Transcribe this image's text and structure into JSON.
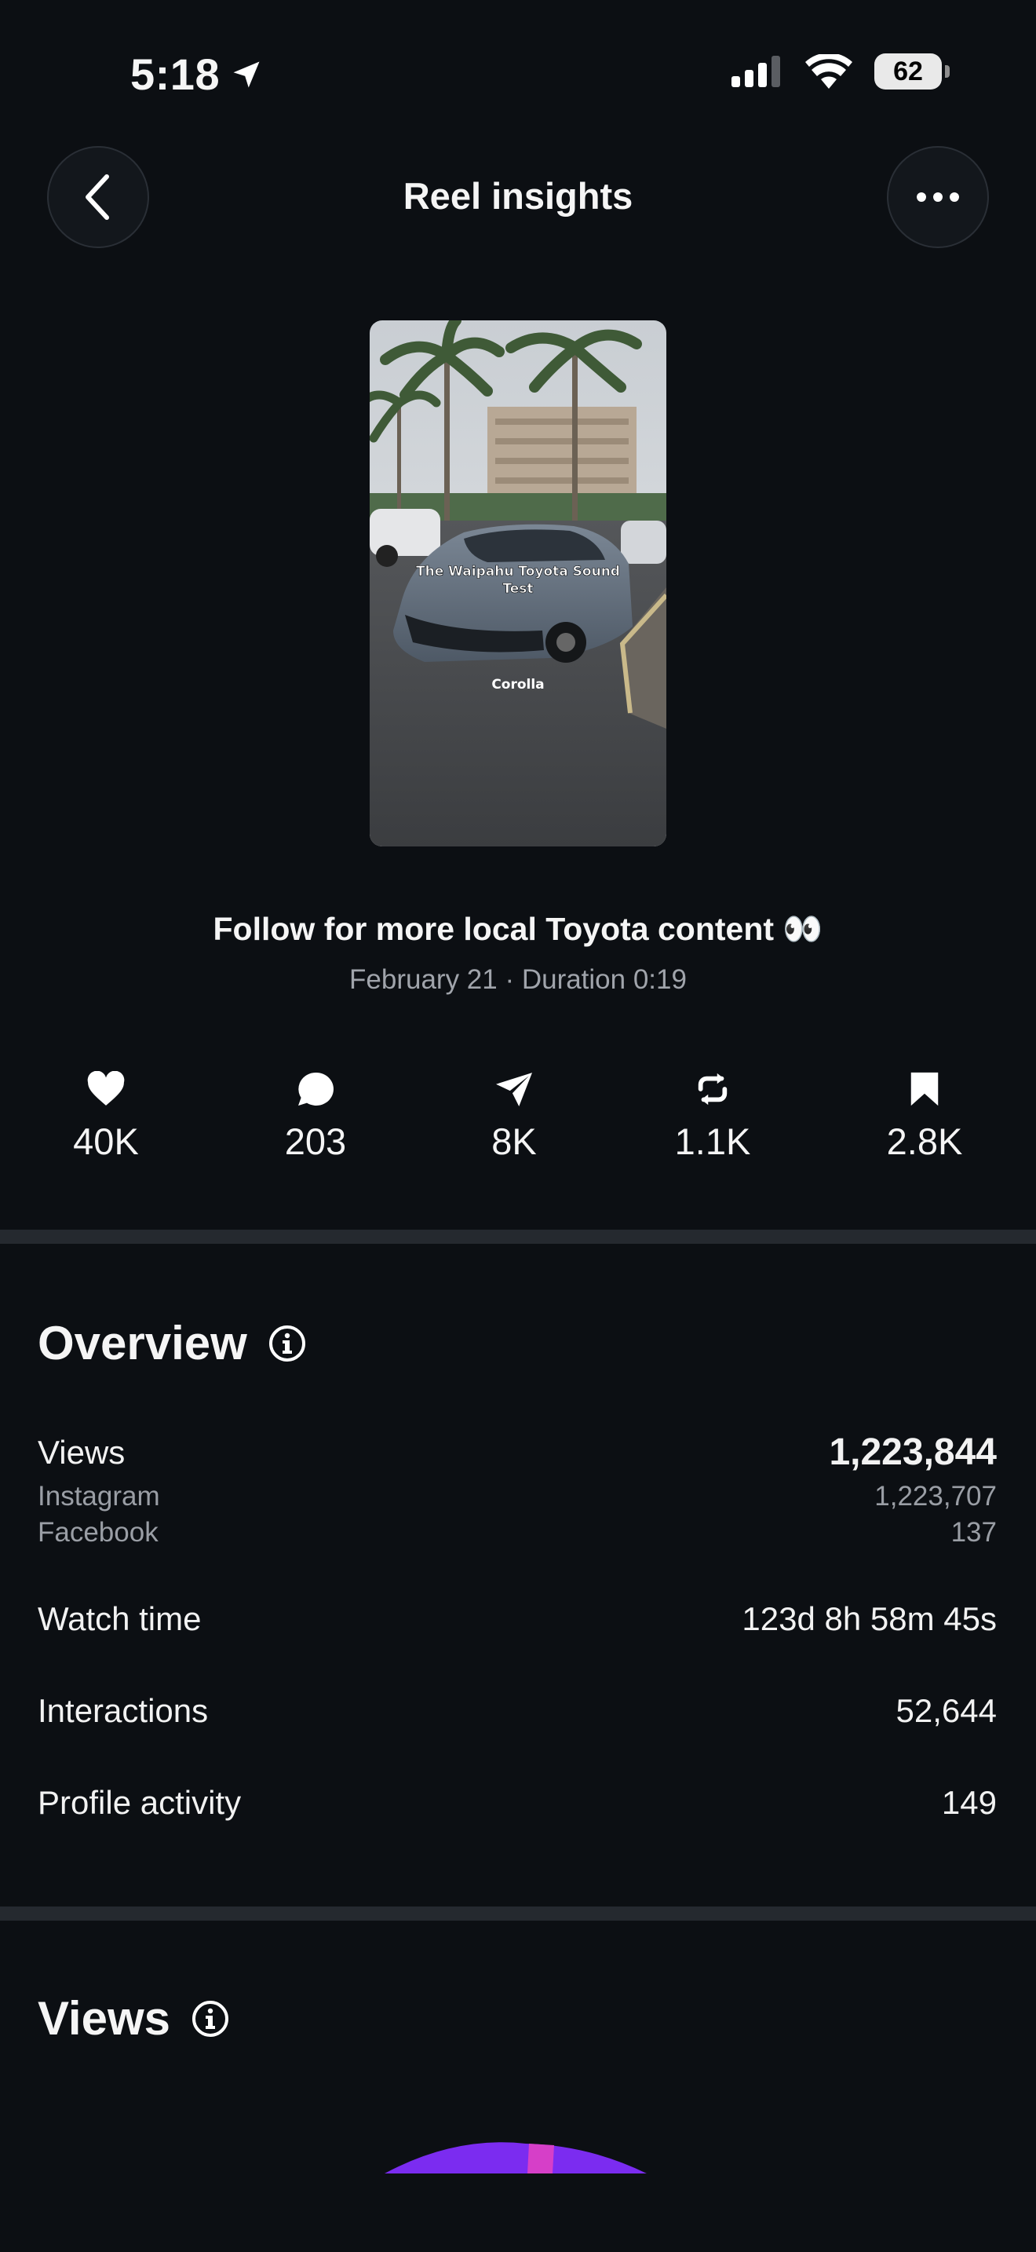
{
  "status_bar": {
    "time": "5:18",
    "battery": "62"
  },
  "header": {
    "title": "Reel insights"
  },
  "reel": {
    "overlay_title": "The Waipahu Toyota Sound Test",
    "overlay_label": "Corolla",
    "caption": "Follow for more local Toyota content 👀",
    "meta": "February 21 · Duration 0:19"
  },
  "stats": [
    {
      "icon": "heart-icon",
      "value": "40K"
    },
    {
      "icon": "comment-icon",
      "value": "203"
    },
    {
      "icon": "share-icon",
      "value": "8K"
    },
    {
      "icon": "repost-icon",
      "value": "1.1K"
    },
    {
      "icon": "save-icon",
      "value": "2.8K"
    }
  ],
  "overview": {
    "title": "Overview",
    "views_label": "Views",
    "views_value": "1,223,844",
    "instagram_label": "Instagram",
    "instagram_value": "1,223,707",
    "facebook_label": "Facebook",
    "facebook_value": "137",
    "watch_time_label": "Watch time",
    "watch_time_value": "123d 8h 58m 45s",
    "interactions_label": "Interactions",
    "interactions_value": "52,644",
    "profile_activity_label": "Profile activity",
    "profile_activity_value": "149"
  },
  "views_section": {
    "title": "Views"
  },
  "colors": {
    "background": "#0c0f13",
    "accent_purple": "#7b2cf0",
    "accent_pink": "#d63fc8"
  }
}
